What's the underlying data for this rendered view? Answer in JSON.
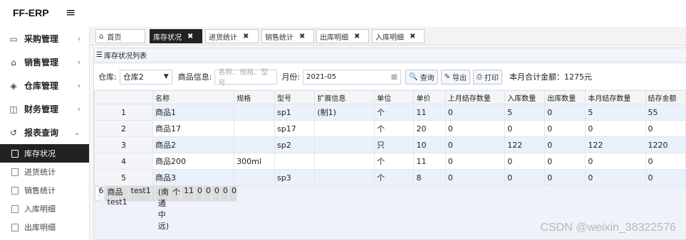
{
  "brand": "FF-ERP",
  "menu_icon": "hamburger-icon",
  "sidebar": {
    "groups": [
      {
        "label": "采购管理",
        "icon": "monitor-icon",
        "glyph": "▭",
        "chevron": "‹"
      },
      {
        "label": "销售管理",
        "icon": "briefcase-icon",
        "glyph": "⌂",
        "chevron": "‹"
      },
      {
        "label": "仓库管理",
        "icon": "layers-icon",
        "glyph": "◈",
        "chevron": "‹"
      },
      {
        "label": "财务管理",
        "icon": "book-icon",
        "glyph": "◫",
        "chevron": "‹"
      },
      {
        "label": "报表查询",
        "icon": "history-icon",
        "glyph": "↺",
        "chevron": "⌄"
      }
    ],
    "subitems": [
      {
        "label": "库存状况",
        "active": true
      },
      {
        "label": "进货统计"
      },
      {
        "label": "销售统计"
      },
      {
        "label": "入库明细"
      },
      {
        "label": "出库明细"
      }
    ]
  },
  "tabs": [
    {
      "label": "首页",
      "icon": "home-icon",
      "glyph": "⌂"
    },
    {
      "label": "库存状况",
      "active": true,
      "close": "✖"
    },
    {
      "label": "进货统计",
      "close": "✖"
    },
    {
      "label": "销售统计",
      "close": "✖"
    },
    {
      "label": "出库明细",
      "close": "✖"
    },
    {
      "label": "入库明细",
      "close": "✖"
    }
  ],
  "panel": {
    "title": "库存状况列表",
    "title_icon": "list-icon"
  },
  "filters": {
    "warehouse_label": "仓库:",
    "warehouse_value": "仓库2",
    "product_label": "商品信息:",
    "product_placeholder": "名称、规格、型号",
    "month_label": "月份:",
    "month_value": "2021-05",
    "query_label": "查询",
    "export_label": "导出",
    "print_label": "打印",
    "total_text": "本月合计金额：1275元"
  },
  "table": {
    "columns": [
      "",
      "名称",
      "规格",
      "型号",
      "扩展信息",
      "单位",
      "单价",
      "上月结存数量",
      "入库数量",
      "出库数量",
      "本月结存数量",
      "结存金额"
    ],
    "rows": [
      [
        "1",
        "商品1",
        "",
        "sp1",
        "(制1)",
        "个",
        "11",
        "0",
        "5",
        "0",
        "5",
        "55"
      ],
      [
        "2",
        "商品17",
        "",
        "sp17",
        "",
        "个",
        "20",
        "0",
        "0",
        "0",
        "0",
        "0"
      ],
      [
        "3",
        "商品2",
        "",
        "sp2",
        "",
        "只",
        "10",
        "0",
        "122",
        "0",
        "122",
        "1220"
      ],
      [
        "4",
        "商品200",
        "300ml",
        "",
        "",
        "个",
        "11",
        "0",
        "0",
        "0",
        "0",
        "0"
      ],
      [
        "5",
        "商品3",
        "",
        "sp3",
        "",
        "个",
        "8",
        "0",
        "0",
        "0",
        "0",
        "0"
      ],
      [
        "6",
        "商品test1",
        "test1",
        "",
        "(南通中远)",
        "个",
        "11",
        "0",
        "0",
        "0",
        "0",
        "0"
      ]
    ]
  },
  "watermark": "CSDN @weixin_38322576"
}
